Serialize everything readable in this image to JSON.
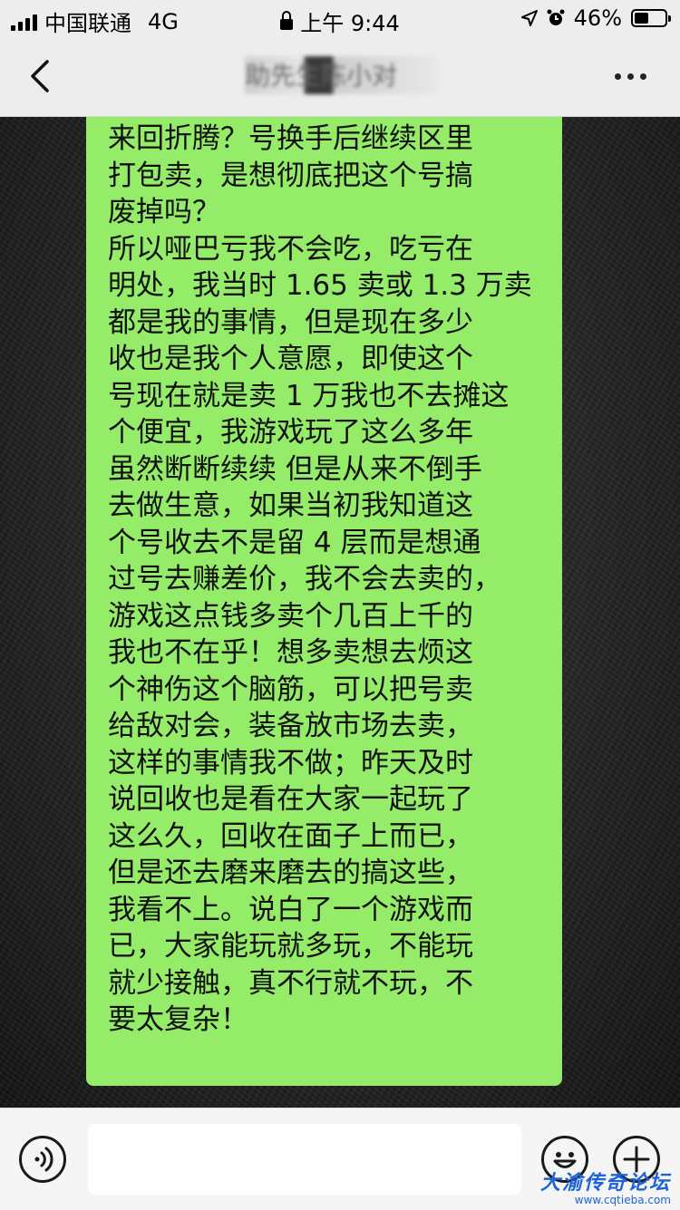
{
  "status_bar": {
    "carrier": "中国联通",
    "network": "4G",
    "time": "上午 9:44",
    "battery": "46%",
    "battery_level": 0.46
  },
  "nav": {
    "title": "助先生陈小对"
  },
  "message": {
    "text": "来回折腾？号换手后继续区里\n打包卖，是想彻底把这个号搞\n废掉吗？\n所以哑巴亏我不会吃，吃亏在\n明处，我当时 1.65 卖或 1.3 万卖\n都是我的事情，但是现在多少\n收也是我个人意愿，即使这个\n号现在就是卖 1 万我也不去摊这\n个便宜，我游戏玩了这么多年\n虽然断断续续 但是从来不倒手\n去做生意，如果当初我知道这\n个号收去不是留 4 层而是想通\n过号去赚差价，我不会去卖的，\n游戏这点钱多卖个几百上千的\n我也不在乎！想多卖想去烦这\n个神伤这个脑筋，可以把号卖\n给敌对会，装备放市场去卖，\n这样的事情我不做；昨天及时\n说回收也是看在大家一起玩了\n这么久，回收在面子上而已，\n但是还去磨来磨去的搞这些，\n我看不上。说白了一个游戏而\n已，大家能玩就多玩，不能玩\n就少接触，真不行就不玩，不\n要太复杂！",
    "bubble_color": "#95ec69"
  },
  "input_bar": {
    "value": "",
    "placeholder": ""
  },
  "icons": {
    "back": "chevron-left-icon",
    "more": "more-dots-icon",
    "voice": "voice-icon",
    "emoji": "emoji-icon",
    "plus": "plus-icon"
  },
  "watermark": {
    "title": "大渝传奇论坛",
    "url": "www.cqtieba.com"
  }
}
